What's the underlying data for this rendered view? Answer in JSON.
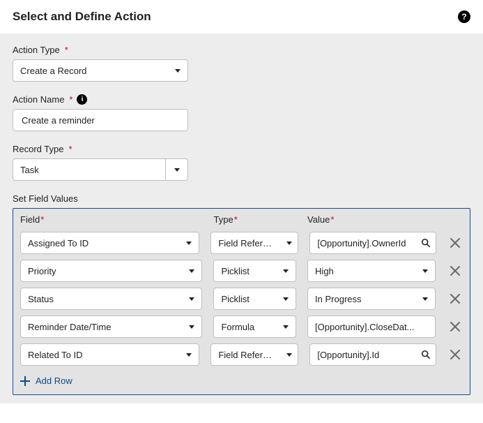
{
  "header": {
    "title": "Select and Define Action",
    "help_tooltip": "Help"
  },
  "actionType": {
    "label": "Action Type",
    "value": "Create a Record"
  },
  "actionName": {
    "label": "Action Name",
    "value": "Create a reminder",
    "info": "Info"
  },
  "recordType": {
    "label": "Record Type",
    "value": "Task"
  },
  "setFieldValues": {
    "title": "Set Field Values",
    "columns": {
      "field": "Field",
      "type": "Type",
      "value": "Value"
    },
    "rows": [
      {
        "field": "Assigned To ID",
        "type": "Field Reference",
        "value": "[Opportunity].OwnerId",
        "valueKind": "lookup"
      },
      {
        "field": "Priority",
        "type": "Picklist",
        "value": "High",
        "valueKind": "picklist"
      },
      {
        "field": "Status",
        "type": "Picklist",
        "value": "In Progress",
        "valueKind": "picklist"
      },
      {
        "field": "Reminder Date/Time",
        "type": "Formula",
        "value": "[Opportunity].CloseDat...",
        "valueKind": "text"
      },
      {
        "field": "Related To ID",
        "type": "Field Reference",
        "value": "[Opportunity].Id",
        "valueKind": "lookup"
      }
    ],
    "addRowLabel": "Add Row"
  }
}
